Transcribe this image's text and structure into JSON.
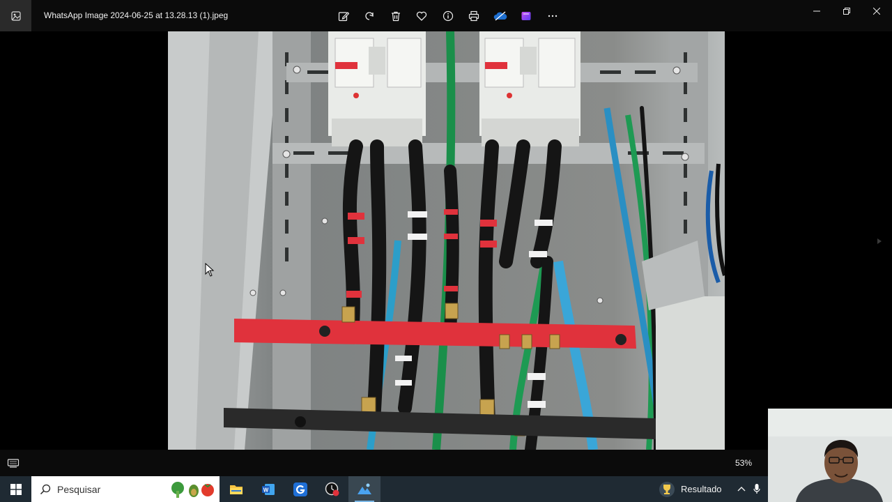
{
  "window": {
    "title": "WhatsApp Image 2024-06-25 at 13.28.13 (1).jpeg"
  },
  "toolbar": {
    "items": [
      "edit-icon",
      "rotate-icon",
      "delete-icon",
      "favorite-icon",
      "info-icon",
      "print-icon",
      "onedrive-icon",
      "clipchamp-icon",
      "more-icon"
    ]
  },
  "status": {
    "zoom": "53%"
  },
  "taskbar": {
    "search_placeholder": "Pesquisar",
    "weather_label": "Resultado",
    "apps": [
      "file-explorer-icon",
      "word-icon",
      "app-g-icon",
      "clock-app-icon",
      "photos-icon"
    ]
  },
  "colors": {
    "titlebar": "#0b0b0b",
    "taskbar": "#1f2a33",
    "accent": "#7ab7e6",
    "busbar_red": "#e0323c"
  }
}
